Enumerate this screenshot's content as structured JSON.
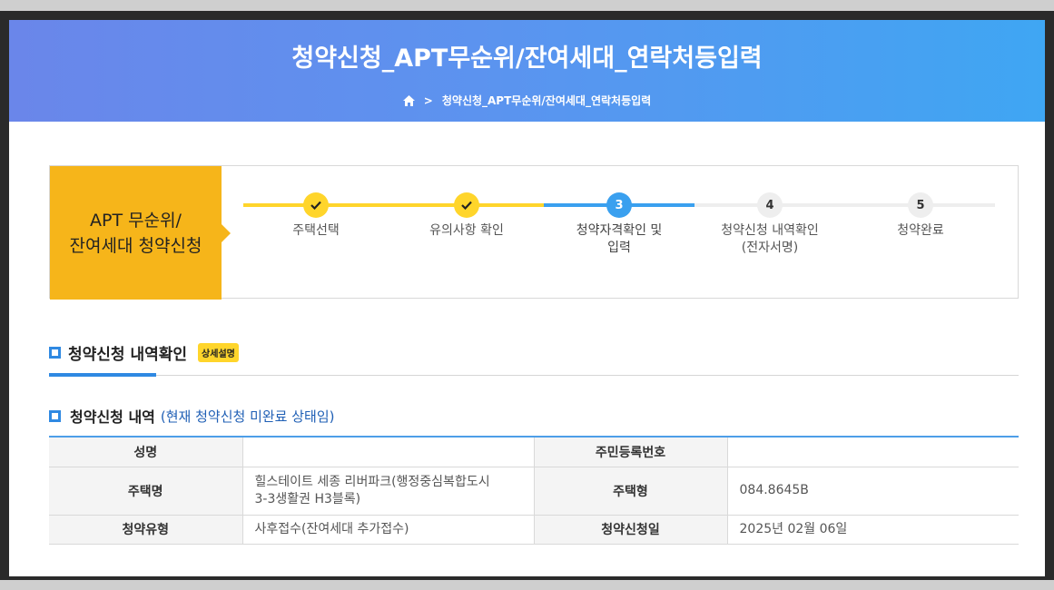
{
  "page": {
    "title": "청약신청_APT무순위/잔여세대_연락처등입력",
    "breadcrumb": {
      "home_icon": "home-icon",
      "separator": ">",
      "current": "청약신청_APT무순위/잔여세대_연락처등입력"
    }
  },
  "steps": {
    "box_title_line1": "APT 무순위/",
    "box_title_line2": "잔여세대 청약신청",
    "items": [
      {
        "number": "✓",
        "label_line1": "주택선택",
        "label_line2": "",
        "status": "done"
      },
      {
        "number": "✓",
        "label_line1": "유의사항 확인",
        "label_line2": "",
        "status": "done"
      },
      {
        "number": "3",
        "label_line1": "청약자격확인 및",
        "label_line2": "입력",
        "status": "active"
      },
      {
        "number": "4",
        "label_line1": "청약신청 내역확인",
        "label_line2": "(전자서명)",
        "status": "todo"
      },
      {
        "number": "5",
        "label_line1": "청약완료",
        "label_line2": "",
        "status": "todo"
      }
    ],
    "colors": {
      "done": "#ffd52b",
      "active": "#3aa0ef",
      "todo": "#eeeeee"
    }
  },
  "section1": {
    "title": "청약신청 내역확인",
    "badge": "상세설명"
  },
  "section2": {
    "title": "청약신청 내역",
    "note": "(현재 청약신청 미완료 상태임)"
  },
  "table": {
    "rows": [
      {
        "label1": "성명",
        "value1": "",
        "label2": "주민등록번호",
        "value2": ""
      },
      {
        "label1": "주택명",
        "value1_line1": "힐스테이트 세종 리버파크(행정중심복합도시",
        "value1_line2": "3-3생활권 H3블록)",
        "label2": "주택형",
        "value2": "084.8645B"
      },
      {
        "label1": "청약유형",
        "value1": "사후접수(잔여세대 추가접수)",
        "label2": "청약신청일",
        "value2": "2025년 02월 06일"
      }
    ]
  },
  "colors": {
    "header_gradient_start": "#6a86ea",
    "header_gradient_end": "#3fa6f3",
    "accent_yellow": "#f6b51a",
    "accent_blue": "#2f89e2",
    "note_blue": "#1f5fb5"
  }
}
